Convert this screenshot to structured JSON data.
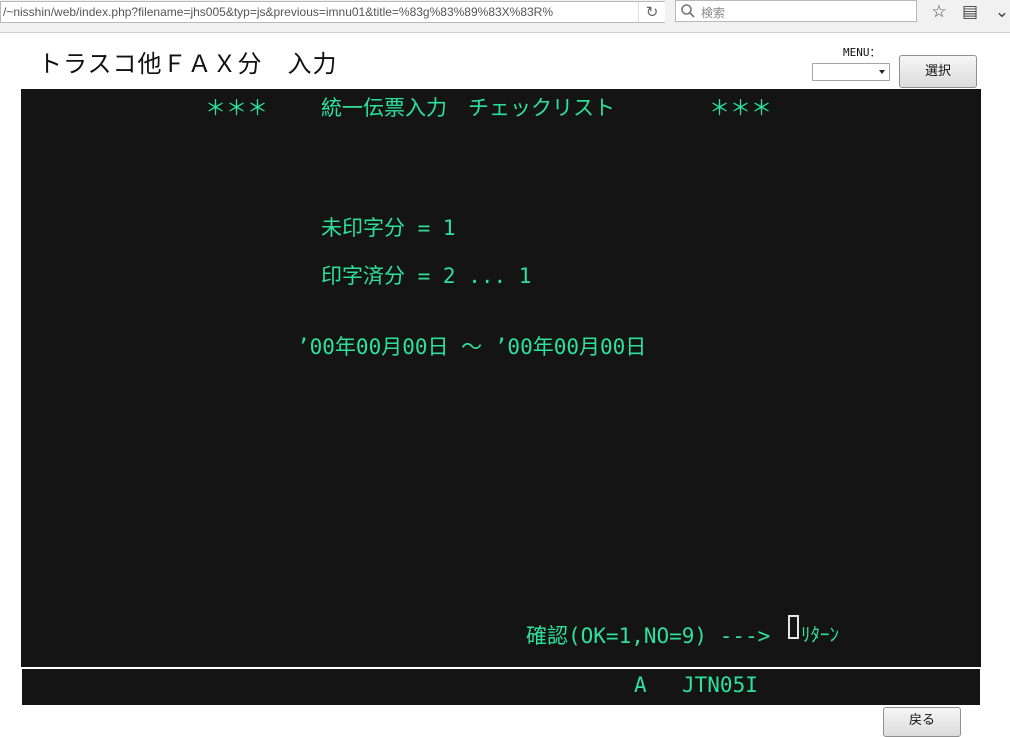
{
  "browser": {
    "url": "/~nisshin/web/index.php?filename=jhs005&typ=js&previous=imnu01&title=%83g%83%89%83X%83R%",
    "search_placeholder": "検索"
  },
  "header": {
    "title": "トラスコ他ＦＡＸ分　入力",
    "menu_label": "MENU：",
    "menu_value": "",
    "select_button": "選択"
  },
  "terminal": {
    "heading_left": "＊＊＊",
    "heading": "統一伝票入力　チェックリスト",
    "heading_right": "＊＊＊",
    "option_unprinted": "未印字分 = 1",
    "option_printed": "印字済分 = 2 ... 1",
    "date_range": "’00年00月00日 ～ ’00年00月00日",
    "confirm_prompt": "確認(OK=1,NO=9) --->",
    "return_label": "ﾘﾀｰﾝ"
  },
  "status_bar": {
    "mode": "A",
    "screen_id": "JTN05I"
  },
  "footer": {
    "back_button": "戻る"
  }
}
